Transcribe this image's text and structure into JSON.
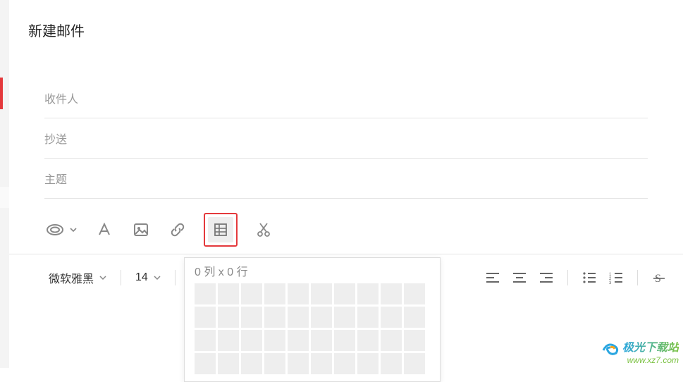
{
  "page": {
    "title": "新建邮件"
  },
  "fields": {
    "recipient_label": "收件人",
    "cc_label": "抄送",
    "subject_label": "主题"
  },
  "toolbar": {
    "font_family": "微软雅黑",
    "font_size": "14"
  },
  "table_popup": {
    "label": "0 列 x 0 行",
    "cols": 10,
    "rows": 4
  },
  "watermark": {
    "text": "极光下载站",
    "url": "www.xz7.com"
  }
}
